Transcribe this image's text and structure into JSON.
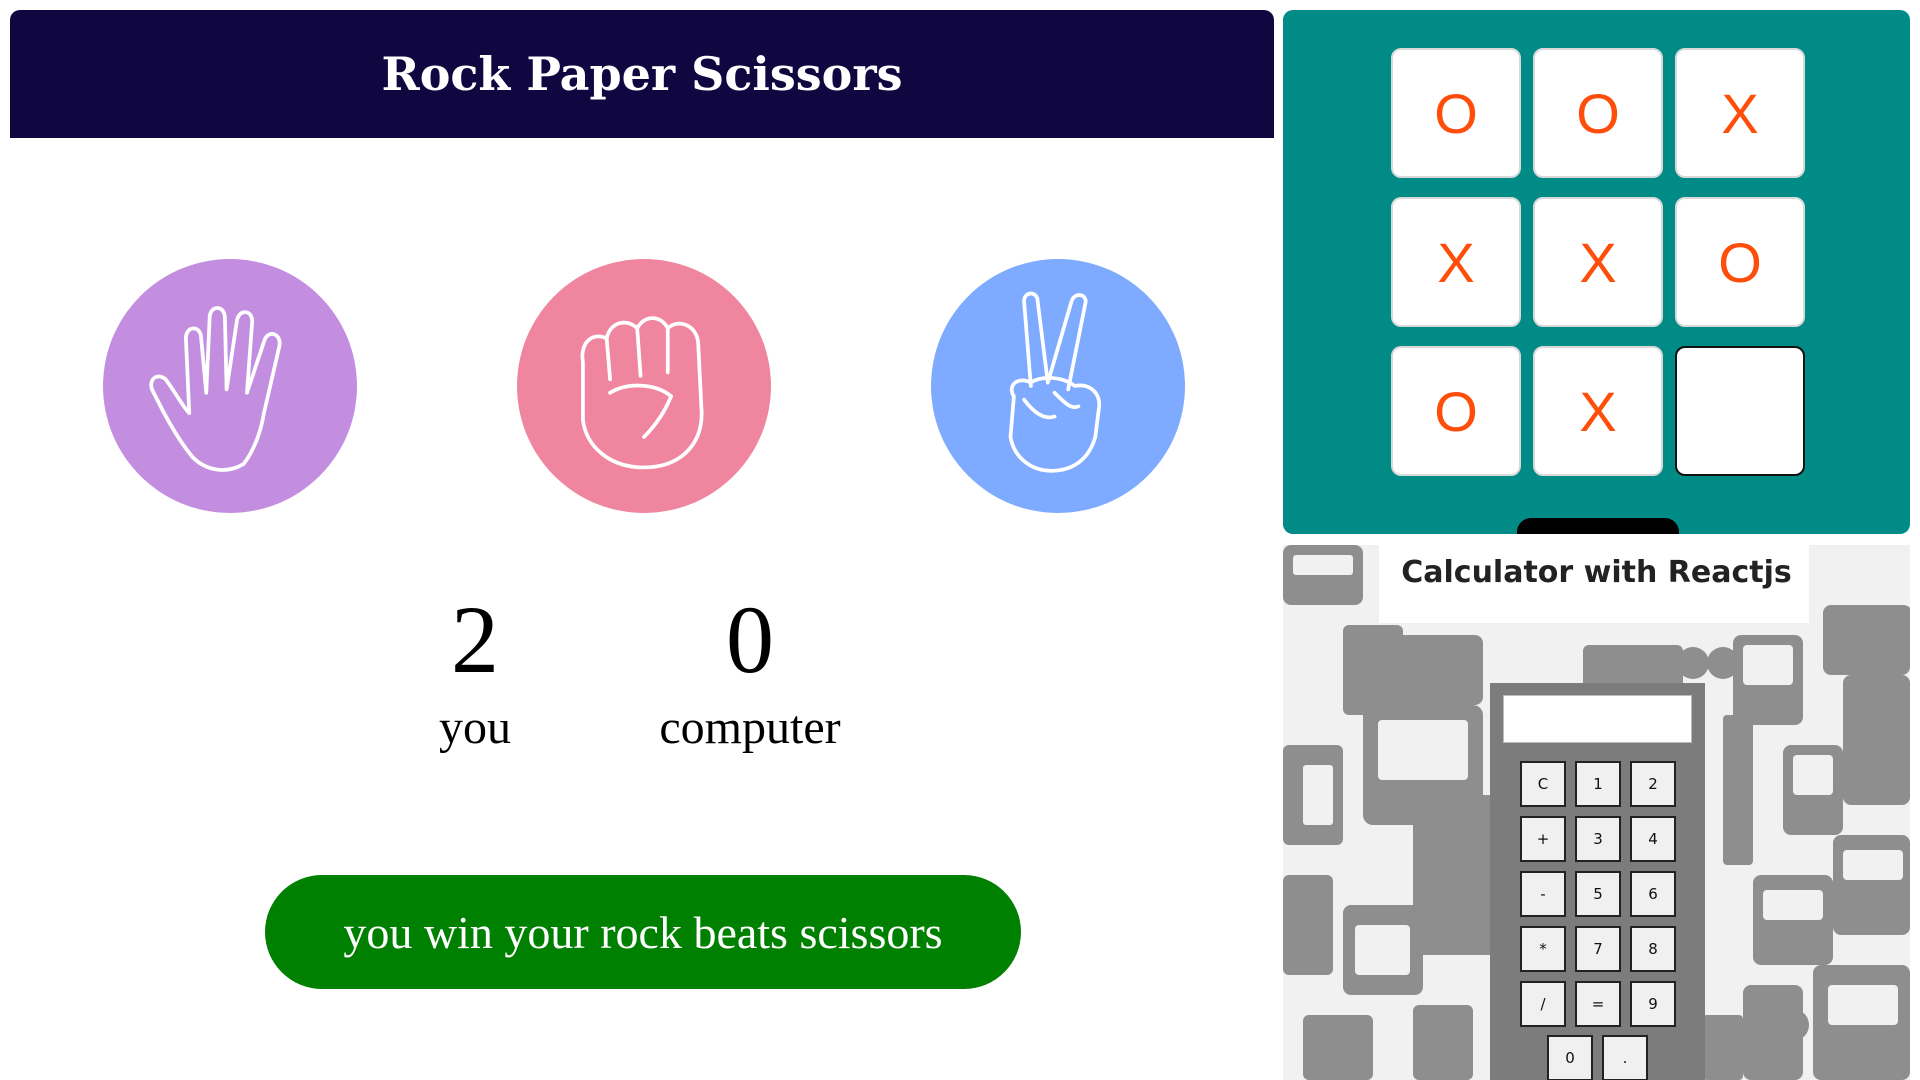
{
  "rps": {
    "title": "Rock Paper Scissors",
    "choices": [
      {
        "name": "paper",
        "color": "#c38ee0",
        "icon": "open-hand-icon"
      },
      {
        "name": "rock",
        "color": "#f0859f",
        "icon": "fist-icon"
      },
      {
        "name": "scissors",
        "color": "#7eabff",
        "icon": "peace-hand-icon"
      }
    ],
    "score": {
      "you": {
        "value": "2",
        "label": "you"
      },
      "computer": {
        "value": "0",
        "label": "computer"
      }
    },
    "result": {
      "text": "you win your rock beats scissors",
      "color": "#008000"
    },
    "header_color": "#100740"
  },
  "tictactoe": {
    "background": "#008b87",
    "mark_color": "#ff4d0a",
    "cells": [
      "O",
      "O",
      "X",
      "X",
      "X",
      "O",
      "O",
      "X",
      ""
    ]
  },
  "calculator": {
    "title": "Calculator with Reactjs",
    "display": "",
    "keys": [
      "C",
      "1",
      "2",
      "+",
      "3",
      "4",
      "-",
      "5",
      "6",
      "*",
      "7",
      "8",
      "/",
      "=",
      "9",
      "0",
      "."
    ]
  }
}
